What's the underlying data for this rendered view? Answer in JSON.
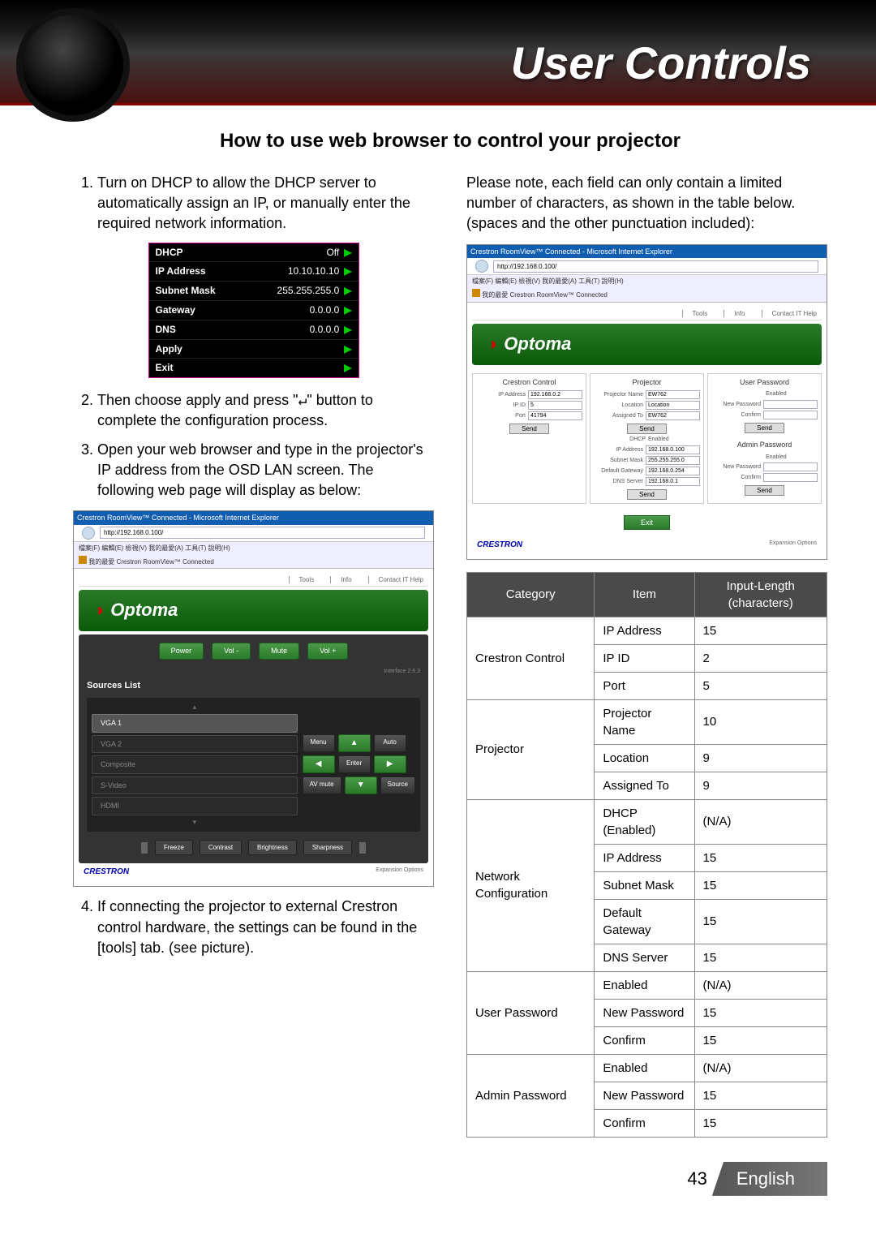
{
  "header": {
    "title": "User Controls"
  },
  "subtitle": "How to use web browser to control your projector",
  "steps": {
    "s1": "Turn on DHCP to allow the DHCP server to automatically assign an IP, or manually enter the required network information.",
    "s2a": "Then choose apply and press \"",
    "s2b": "\" button to complete the configuration process.",
    "s3": "Open your web browser and type in the projector's IP address from the OSD LAN screen. The following web page will display as below:",
    "s4": "If connecting the projector to external Crestron control hardware, the settings can be found in the [tools] tab. (see picture)."
  },
  "right_intro": "Please note, each field can only contain a limited number of characters, as shown in the table below. (spaces and the other punctuation included):",
  "osd": {
    "dhcp_label": "DHCP",
    "dhcp_value": "Off",
    "ip_label": "IP Address",
    "ip_value": "10.10.10.10",
    "mask_label": "Subnet Mask",
    "mask_value": "255.255.255.0",
    "gw_label": "Gateway",
    "gw_value": "0.0.0.0",
    "dns_label": "DNS",
    "dns_value": "0.0.0.0",
    "apply_label": "Apply",
    "exit_label": "Exit"
  },
  "browser": {
    "window_title": "Crestron RoomView™ Connected - Microsoft Internet Explorer",
    "url1": "http://192.168.0.100/",
    "url2": "http://192.168.0.100/",
    "menu": "檔案(F)  編輯(E)  檢視(V)  我的最愛(A)  工具(T)  說明(H)",
    "fav": "我的最愛    Crestron RoomView™ Connected",
    "tabs": {
      "tools": "Tools",
      "info": "Info",
      "contact": "Contact IT Help"
    },
    "brand": "Optoma",
    "expansion": "Expansion Options",
    "interface": "Interface 2.6.3"
  },
  "main_ui": {
    "power": "Power",
    "volm": "Vol -",
    "mute": "Mute",
    "volp": "Vol +",
    "sources_title": "Sources List",
    "sources": [
      "VGA 1",
      "VGA 2",
      "Composite",
      "S-Video",
      "HDMI"
    ],
    "menu": "Menu",
    "auto": "Auto",
    "enter": "Enter",
    "avmute": "AV mute",
    "source": "Source",
    "freeze": "Freeze",
    "contrast": "Contrast",
    "brightness": "Brightness",
    "sharpness": "Sharpness",
    "crestron": "CRESTRON"
  },
  "tools_ui": {
    "col1_title": "Crestron Control",
    "col2_title": "Projector",
    "col3_title": "User Password",
    "ip_addr_l": "IP Address",
    "ip_addr_v": "192.168.0.2",
    "ipid_l": "IP ID",
    "ipid_v": "5",
    "port_l": "Port",
    "port_v": "41794",
    "pname_l": "Projector Name",
    "pname_v": "EW762",
    "loc_l": "Location",
    "loc_v": "Location",
    "ass_l": "Assigned To",
    "ass_v": "EW762",
    "dhcp_l": "DHCP",
    "dhcp_v": "Enabled",
    "ipa_l": "IP Address",
    "ipa_v": "192.168.0.100",
    "sm_l": "Subnet Mask",
    "sm_v": "255.255.255.0",
    "dg_l": "Default Gateway",
    "dg_v": "192.168.0.254",
    "dns_l": "DNS Server",
    "dns_v": "192.168.0.1",
    "en_l": "Enabled",
    "np_l": "New Password",
    "cf_l": "Confirm",
    "admin_title": "Admin Password",
    "send": "Send",
    "exit": "Exit"
  },
  "dtable": {
    "headers": [
      "Category",
      "Item",
      "Input-Length (characters)"
    ],
    "rows": [
      {
        "cat": "Crestron Control",
        "span": 3,
        "items": [
          [
            "IP Address",
            "15"
          ],
          [
            "IP ID",
            "2"
          ],
          [
            "Port",
            "5"
          ]
        ]
      },
      {
        "cat": "Projector",
        "span": 3,
        "items": [
          [
            "Projector Name",
            "10"
          ],
          [
            "Location",
            "9"
          ],
          [
            "Assigned To",
            "9"
          ]
        ]
      },
      {
        "cat": "Network Configuration",
        "span": 5,
        "items": [
          [
            "DHCP (Enabled)",
            "(N/A)"
          ],
          [
            "IP Address",
            "15"
          ],
          [
            "Subnet Mask",
            "15"
          ],
          [
            "Default Gateway",
            "15"
          ],
          [
            "DNS Server",
            "15"
          ]
        ]
      },
      {
        "cat": "User Password",
        "span": 3,
        "items": [
          [
            "Enabled",
            "(N/A)"
          ],
          [
            "New Password",
            "15"
          ],
          [
            "Confirm",
            "15"
          ]
        ]
      },
      {
        "cat": "Admin Password",
        "span": 3,
        "items": [
          [
            "Enabled",
            "(N/A)"
          ],
          [
            "New Password",
            "15"
          ],
          [
            "Confirm",
            "15"
          ]
        ]
      }
    ]
  },
  "footer": {
    "page": "43",
    "lang": "English"
  }
}
